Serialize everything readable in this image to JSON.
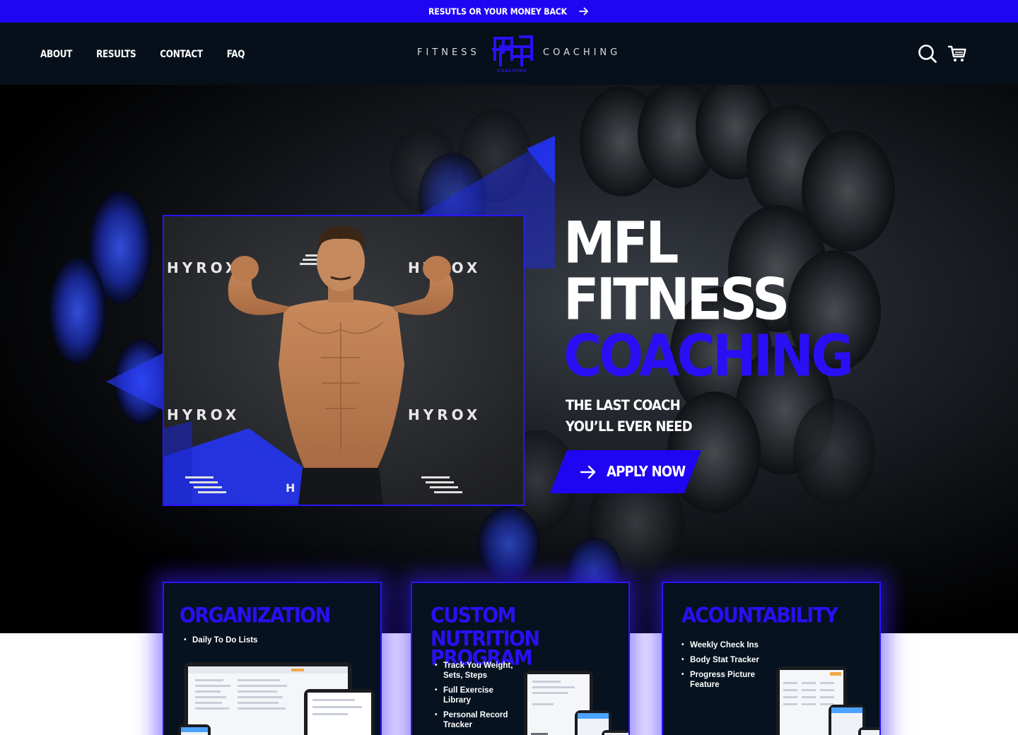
{
  "announcement": {
    "text": "RESUTLS OR YOUR MONEY BACK",
    "icon": "arrow-right-icon"
  },
  "nav": {
    "items": [
      "ABOUT",
      "RESULTS",
      "CONTACT",
      "FAQ"
    ]
  },
  "logo": {
    "left_word": "FITNESS",
    "right_word": "COACHING",
    "monogram_caption": "COACHING"
  },
  "header_icons": [
    "search-icon",
    "cart-icon"
  ],
  "hero": {
    "title_line1": "MFL",
    "title_line2": "FITNESS",
    "title_line3": "COACHING",
    "subtitle_line1": "THE LAST COACH",
    "subtitle_line2": "YOU’LL EVER NEED",
    "cta_label": "APPLY NOW",
    "photo_banner_text": "HYROX"
  },
  "cards": [
    {
      "title_lines": [
        "ORGANIZATION"
      ],
      "bullets": [
        "Daily To Do Lists"
      ]
    },
    {
      "title_lines": [
        "CUSTOM NUTRITION",
        "PROGRAM"
      ],
      "bullets": [
        "Track You Weight, Sets, Steps",
        "Full Exercise Library",
        "Personal Record Tracker"
      ]
    },
    {
      "title_lines": [
        "ACOUNTABILITY"
      ],
      "bullets": [
        "Weekly Check Ins",
        "Body Stat Tracker",
        "Progress Picture Feature"
      ]
    }
  ],
  "colors": {
    "brand_blue": "#1f06f2",
    "header_bg": "#07101a",
    "card_bg": "#061220"
  }
}
